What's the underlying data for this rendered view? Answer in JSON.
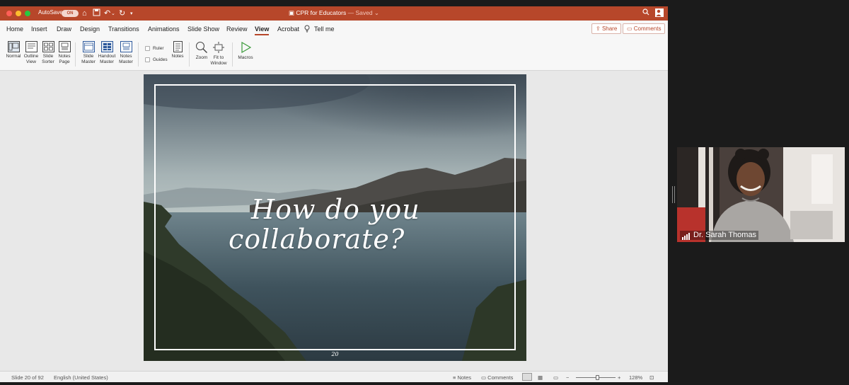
{
  "window": {
    "autosave_label": "AutoSave",
    "autosave_state": "ON",
    "doc_name": "CPR for Educators",
    "doc_status": "— Saved"
  },
  "tabs": [
    "Home",
    "Insert",
    "Draw",
    "Design",
    "Transitions",
    "Animations",
    "Slide Show",
    "Review",
    "View",
    "Acrobat"
  ],
  "active_tab": "View",
  "tell_me": "Tell me",
  "share_label": "Share",
  "comments_label": "Comments",
  "ribbon": {
    "normal": "Normal",
    "outline": [
      "Outline",
      "View"
    ],
    "slide_sorter": [
      "Slide",
      "Sorter"
    ],
    "notes_page": [
      "Notes",
      "Page"
    ],
    "slide_master": [
      "Slide",
      "Master"
    ],
    "handout_master": [
      "Handout",
      "Master"
    ],
    "notes_master": [
      "Notes",
      "Master"
    ],
    "ruler": "Ruler",
    "guides": "Guides",
    "notes": "Notes",
    "zoom": "Zoom",
    "fit": [
      "Fit to",
      "Window"
    ],
    "macros": "Macros"
  },
  "slide": {
    "line1": "How do you",
    "line2": "collaborate?",
    "number": "20"
  },
  "status": {
    "slide_info": "Slide 20 of 92",
    "language": "English (United States)",
    "notes": "Notes",
    "comments": "Comments",
    "zoom_level": "128%",
    "zoom_fraction": 0.55
  },
  "video": {
    "participant": "Dr. Sarah Thomas"
  },
  "colors": {
    "ppt_accent": "#b7472a"
  }
}
